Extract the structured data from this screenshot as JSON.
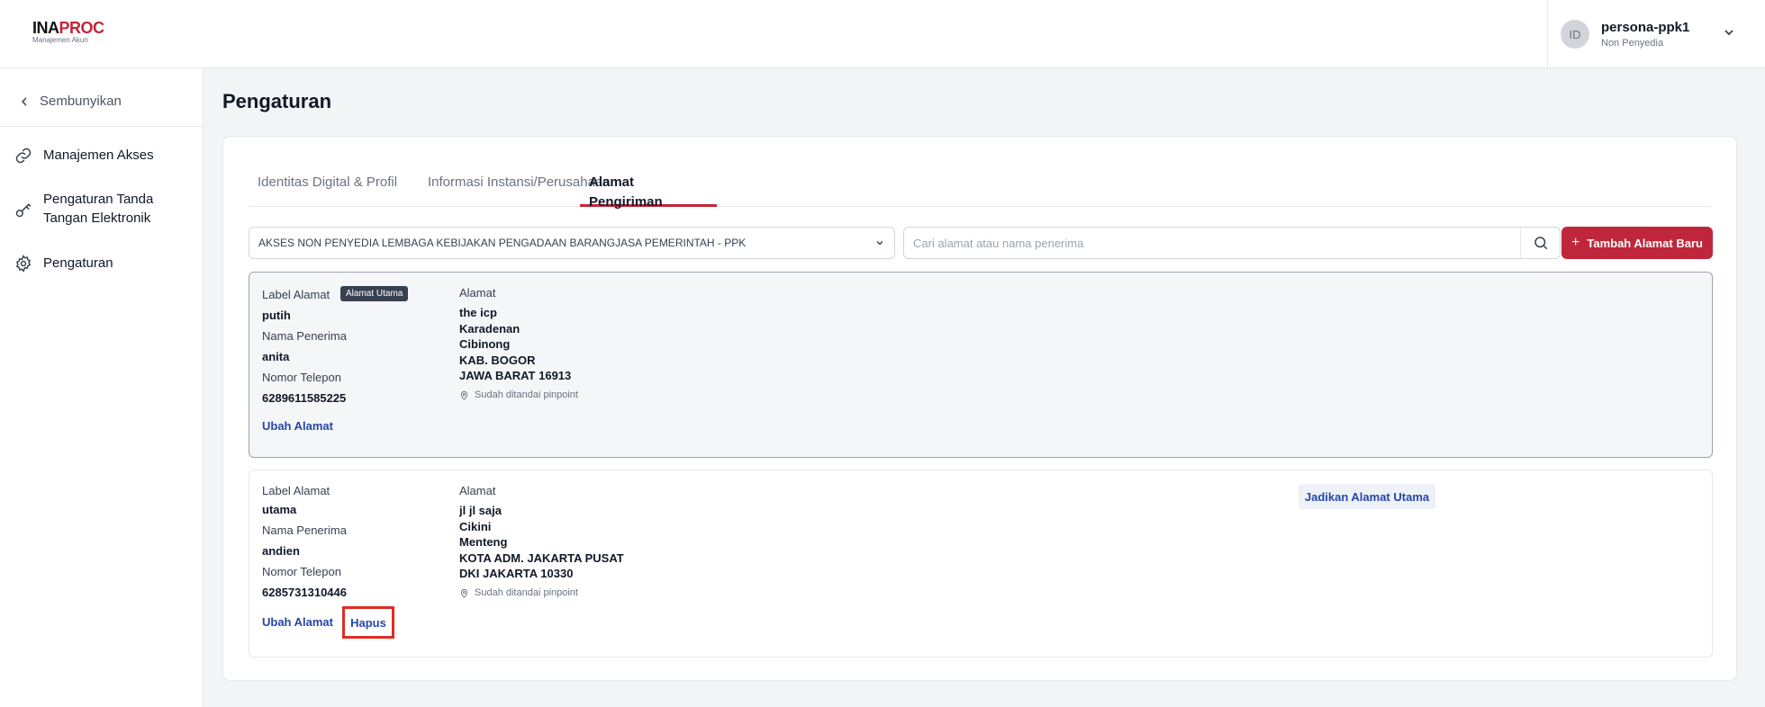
{
  "header": {
    "logo_prefix": "INA",
    "logo_suffix": "PROC",
    "logo_subtitle": "Manajemen Akun",
    "avatar_initials": "ID",
    "user_name": "persona-ppk1",
    "user_role": "Non Penyedia"
  },
  "sidebar": {
    "hide_label": "Sembunyikan",
    "items": [
      {
        "label": "Manajemen Akses",
        "icon": "link-icon"
      },
      {
        "label": "Pengaturan Tanda Tangan Elektronik",
        "icon": "key-icon"
      },
      {
        "label": "Pengaturan",
        "icon": "gear-icon"
      }
    ]
  },
  "page": {
    "title": "Pengaturan"
  },
  "tabs": [
    {
      "label": "Identitas Digital & Profil",
      "active": false
    },
    {
      "label": "Informasi Instansi/Perusahaan",
      "active": false
    },
    {
      "label": "Alamat Pengiriman",
      "active": true
    }
  ],
  "filters": {
    "select_value": "AKSES NON PENYEDIA LEMBAGA KEBIJAKAN PENGADAAN BARANGJASA PEMERINTAH - PPK",
    "search_placeholder": "Cari alamat atau nama penerima",
    "add_button": "Tambah Alamat Baru"
  },
  "labels": {
    "label_alamat": "Label Alamat",
    "nama_penerima": "Nama Penerima",
    "nomor_telepon": "Nomor Telepon",
    "alamat": "Alamat",
    "pinpoint": "Sudah ditandai pinpoint",
    "edit": "Ubah Alamat",
    "delete": "Hapus",
    "make_primary": "Jadikan Alamat Utama",
    "primary_badge": "Alamat Utama"
  },
  "addresses": [
    {
      "label": "putih",
      "recipient": "anita",
      "phone": "6289611585225",
      "lines": [
        "the icp",
        "Karadenan",
        "Cibinong",
        "KAB. BOGOR",
        "JAWA BARAT 16913"
      ],
      "is_primary": true
    },
    {
      "label": "utama",
      "recipient": "andien",
      "phone": "6285731310446",
      "lines": [
        "jl jl saja",
        "Cikini",
        "Menteng",
        "KOTA ADM. JAKARTA PUSAT",
        "DKI JAKARTA 10330"
      ],
      "is_primary": false
    }
  ],
  "colors": {
    "brand_red": "#c0263b",
    "link_blue": "#2547a8",
    "highlight_red": "#e02d21"
  }
}
